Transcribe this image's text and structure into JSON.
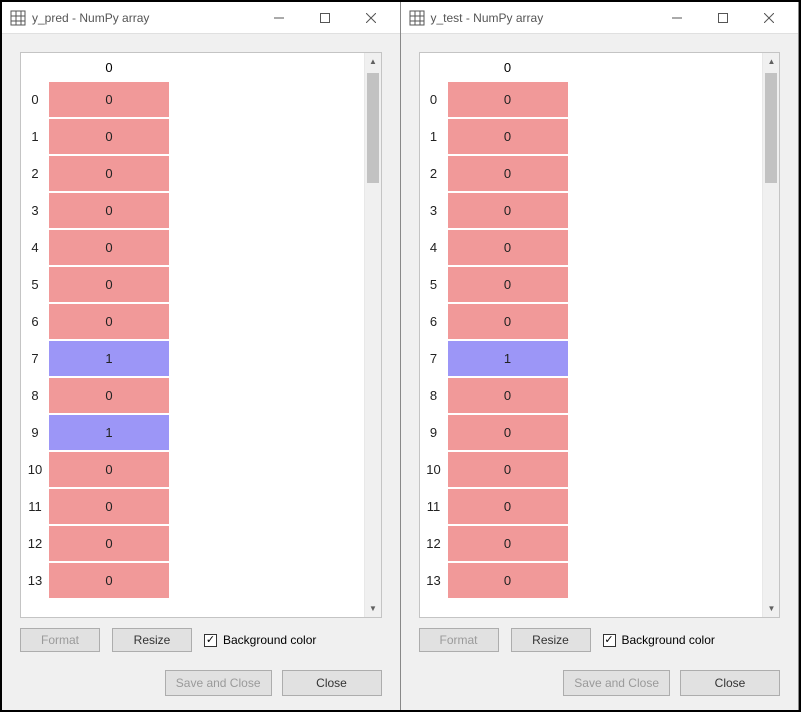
{
  "windows": [
    {
      "title": "y_pred - NumPy array",
      "column_header": "0",
      "rows": [
        {
          "idx": "0",
          "val": "0",
          "cls": "c0"
        },
        {
          "idx": "1",
          "val": "0",
          "cls": "c0"
        },
        {
          "idx": "2",
          "val": "0",
          "cls": "c0"
        },
        {
          "idx": "3",
          "val": "0",
          "cls": "c0"
        },
        {
          "idx": "4",
          "val": "0",
          "cls": "c0"
        },
        {
          "idx": "5",
          "val": "0",
          "cls": "c0"
        },
        {
          "idx": "6",
          "val": "0",
          "cls": "c0"
        },
        {
          "idx": "7",
          "val": "1",
          "cls": "c1"
        },
        {
          "idx": "8",
          "val": "0",
          "cls": "c0"
        },
        {
          "idx": "9",
          "val": "1",
          "cls": "c1"
        },
        {
          "idx": "10",
          "val": "0",
          "cls": "c0"
        },
        {
          "idx": "11",
          "val": "0",
          "cls": "c0"
        },
        {
          "idx": "12",
          "val": "0",
          "cls": "c0"
        },
        {
          "idx": "13",
          "val": "0",
          "cls": "c0"
        }
      ],
      "format_label": "Format",
      "resize_label": "Resize",
      "bg_label": "Background color",
      "bg_checked": true,
      "save_label": "Save and Close",
      "close_label": "Close"
    },
    {
      "title": "y_test - NumPy array",
      "column_header": "0",
      "rows": [
        {
          "idx": "0",
          "val": "0",
          "cls": "c0"
        },
        {
          "idx": "1",
          "val": "0",
          "cls": "c0"
        },
        {
          "idx": "2",
          "val": "0",
          "cls": "c0"
        },
        {
          "idx": "3",
          "val": "0",
          "cls": "c0"
        },
        {
          "idx": "4",
          "val": "0",
          "cls": "c0"
        },
        {
          "idx": "5",
          "val": "0",
          "cls": "c0"
        },
        {
          "idx": "6",
          "val": "0",
          "cls": "c0"
        },
        {
          "idx": "7",
          "val": "1",
          "cls": "c1"
        },
        {
          "idx": "8",
          "val": "0",
          "cls": "c0"
        },
        {
          "idx": "9",
          "val": "0",
          "cls": "c0"
        },
        {
          "idx": "10",
          "val": "0",
          "cls": "c0"
        },
        {
          "idx": "11",
          "val": "0",
          "cls": "c0"
        },
        {
          "idx": "12",
          "val": "0",
          "cls": "c0"
        },
        {
          "idx": "13",
          "val": "0",
          "cls": "c0"
        }
      ],
      "format_label": "Format",
      "resize_label": "Resize",
      "bg_label": "Background color",
      "bg_checked": true,
      "save_label": "Save and Close",
      "close_label": "Close"
    }
  ]
}
